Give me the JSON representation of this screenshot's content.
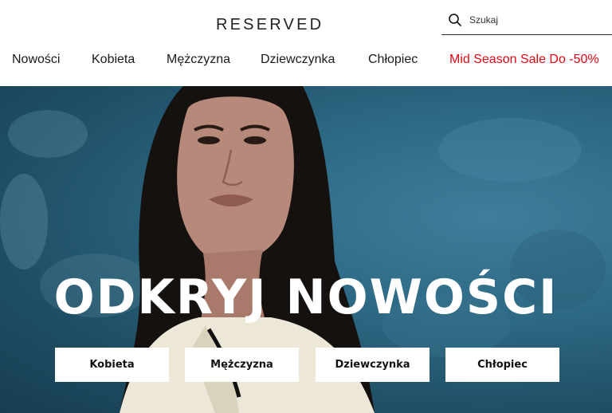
{
  "header": {
    "logo": "RESERVED",
    "search": {
      "placeholder": "Szukaj"
    }
  },
  "nav": {
    "items": [
      {
        "label": "Nowości"
      },
      {
        "label": "Kobieta"
      },
      {
        "label": "Mężczyzna"
      },
      {
        "label": "Dziewczynka"
      },
      {
        "label": "Chłopiec"
      },
      {
        "label": "Mid Season Sale Do -50%",
        "color": "#e30613"
      }
    ]
  },
  "hero": {
    "title": "ODKRYJ NOWOŚCI",
    "buttons": [
      {
        "label": "Kobieta"
      },
      {
        "label": "Mężczyzna"
      },
      {
        "label": "Dziewczynka"
      },
      {
        "label": "Chłopiec"
      }
    ]
  }
}
